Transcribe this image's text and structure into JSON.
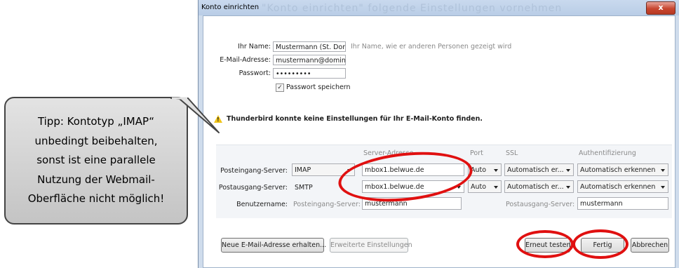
{
  "dialog": {
    "title": "Konto einrichten",
    "ghost_title": "\"Konto einrichten\" folgende Einstellungen vornehmen",
    "close_label": "x"
  },
  "form": {
    "name_label": "Ihr Name:",
    "name_value": "Mustermann (St. Domi",
    "name_hint": "Ihr Name, wie er anderen Personen gezeigt wird",
    "email_label": "E-Mail-Adresse:",
    "email_value": "mustermann@dominik",
    "password_label": "Passwort:",
    "password_value": "•••••••••",
    "remember_label": "Passwort speichern",
    "remember_checked": "✓"
  },
  "warning": {
    "text": "Thunderbird konnte keine Einstellungen für Ihr E-Mail-Konto finden."
  },
  "server_table": {
    "headers": {
      "address": "Server-Adresse",
      "port": "Port",
      "ssl": "SSL",
      "auth": "Authentifizierung"
    },
    "incoming": {
      "label": "Posteingang-Server:",
      "protocol": "IMAP",
      "address": "mbox1.belwue.de",
      "port": "Auto",
      "ssl": "Automatisch er...",
      "auth": "Automatisch erkennen"
    },
    "outgoing": {
      "label": "Postausgang-Server:",
      "protocol": "SMTP",
      "address": "mbox1.belwue.de",
      "port": "Auto",
      "ssl": "Automatisch er...",
      "auth": "Automatisch erkennen"
    },
    "username": {
      "label": "Benutzername:",
      "incoming_label": "Posteingang-Server:",
      "incoming_value": "mustermann",
      "outgoing_label": "Postausgang-Server:",
      "outgoing_value": "mustermann"
    }
  },
  "buttons": {
    "new_address": "Neue E-Mail-Adresse erhalten...",
    "advanced": "Erweiterte Einstellungen",
    "retest": "Erneut testen",
    "done": "Fertig",
    "cancel": "Abbrechen"
  },
  "tooltip": {
    "line1": "Tipp: Kontotyp „IMAP“",
    "line2": "unbedingt beibehalten,",
    "line3": "sonst ist eine parallele",
    "line4": "Nutzung der Webmail-",
    "line5": "Oberfläche nicht möglich!"
  },
  "colors": {
    "highlight_ring": "#e01010",
    "warning_icon": "#f0c419",
    "window_frame": "#cfdcec"
  }
}
